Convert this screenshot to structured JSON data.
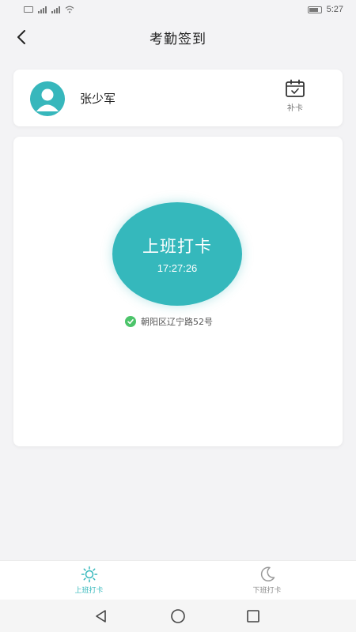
{
  "status_bar": {
    "time": "5:27"
  },
  "header": {
    "title": "考勤签到"
  },
  "user": {
    "name": "张少军",
    "makeup_label": "补卡"
  },
  "clock_in": {
    "label": "上班打卡",
    "time": "17:27:26",
    "location": "朝阳区辽宁路52号"
  },
  "tabs": [
    {
      "label": "上班打卡",
      "icon": "sun-icon",
      "active": true
    },
    {
      "label": "下班打卡",
      "icon": "moon-icon",
      "active": false
    }
  ],
  "colors": {
    "accent": "#35b8bc",
    "success": "#4cc46a"
  }
}
